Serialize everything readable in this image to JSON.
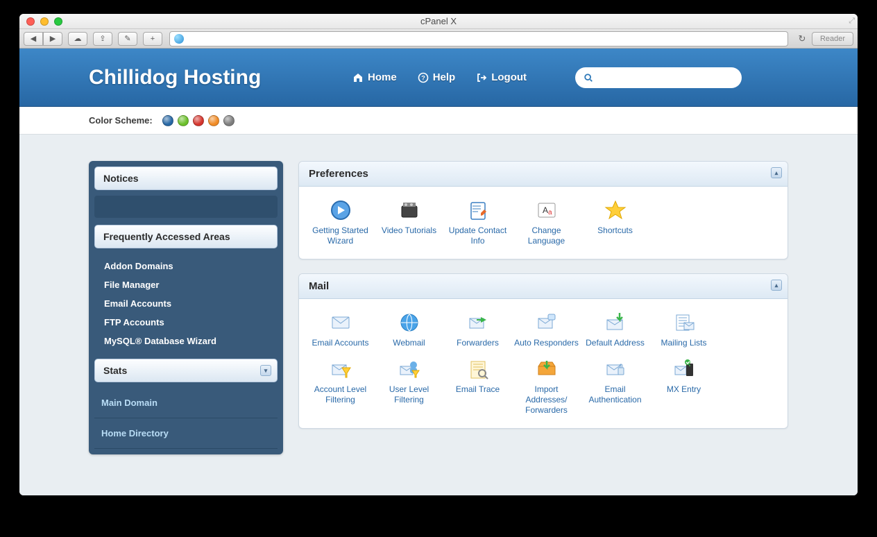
{
  "window": {
    "title": "cPanel X",
    "reader": "Reader"
  },
  "header": {
    "brand": "Chillidog Hosting",
    "nav": {
      "home": "Home",
      "help": "Help",
      "logout": "Logout"
    },
    "search_placeholder": ""
  },
  "scheme": {
    "label": "Color Scheme:",
    "colors": [
      "#2767a4",
      "#6bbf2a",
      "#d4342c",
      "#f08a24",
      "#7d7d7d"
    ]
  },
  "sidebar": {
    "notices": "Notices",
    "freq_title": "Frequently Accessed Areas",
    "freq": [
      "Addon Domains",
      "File Manager",
      "Email Accounts",
      "FTP Accounts",
      "MySQL® Database Wizard"
    ],
    "stats_title": "Stats",
    "stats": [
      "Main Domain",
      "Home Directory"
    ]
  },
  "panels": {
    "prefs": {
      "title": "Preferences",
      "items": [
        "Getting Started Wizard",
        "Video Tutorials",
        "Update Contact Info",
        "Change Language",
        "Shortcuts"
      ]
    },
    "mail": {
      "title": "Mail",
      "items": [
        "Email Accounts",
        "Webmail",
        "Forwarders",
        "Auto Responders",
        "Default Address",
        "Mailing Lists",
        "Account Level Filtering",
        "User Level Filtering",
        "Email Trace",
        "Import Addresses/ Forwarders",
        "Email Authentication",
        "MX Entry"
      ]
    }
  }
}
